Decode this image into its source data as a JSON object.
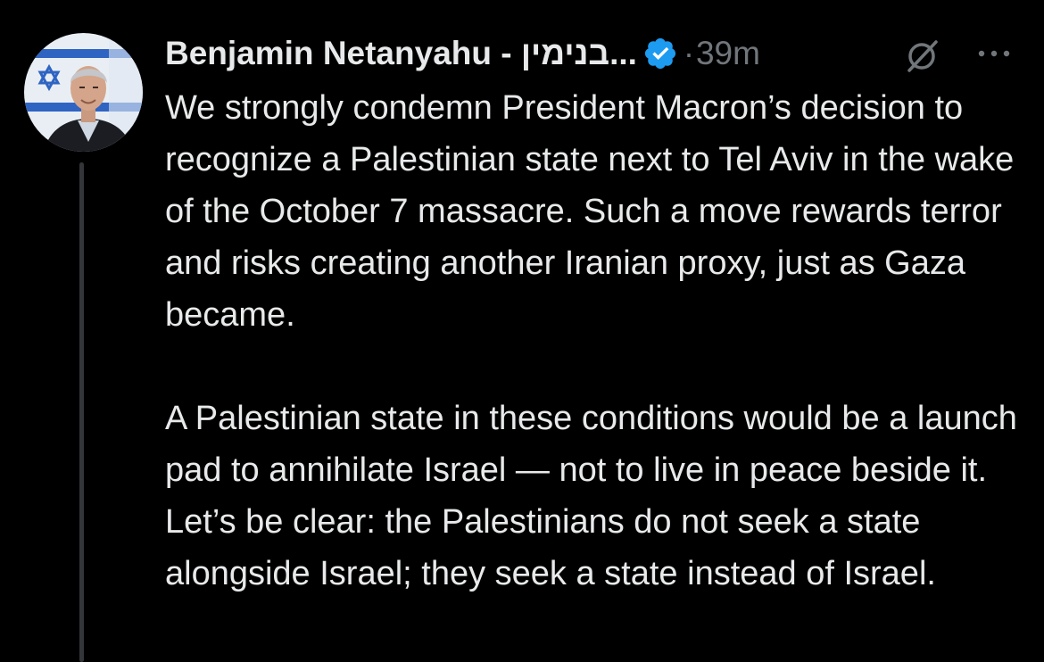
{
  "author": {
    "display_name": "Benjamin Netanyahu - בנימין...",
    "verified_icon": "verified-badge-icon",
    "avatar_icon": "avatar-photo"
  },
  "meta": {
    "separator": "·",
    "timestamp": "39m"
  },
  "actions": {
    "grok_icon": "grok-icon",
    "more_icon": "more-options-icon"
  },
  "tweet": {
    "paragraphs": [
      "We strongly condemn President Macron’s decision to recognize a Palestinian state next to Tel Aviv in the wake of the October 7 massacre. Such a move rewards terror and risks creating another Iranian proxy, just as Gaza became.",
      "A Palestinian state in these conditions would be a launch pad to annihilate Israel — not to live in peace beside it. Let’s be clear: the Palestinians do not seek a state alongside Israel; they seek a state instead of Israel."
    ]
  },
  "colors": {
    "background": "#000000",
    "text_primary": "#e7e9ea",
    "text_secondary": "#71767b",
    "verified_blue": "#1d9bf0",
    "thread_line": "#333639"
  }
}
